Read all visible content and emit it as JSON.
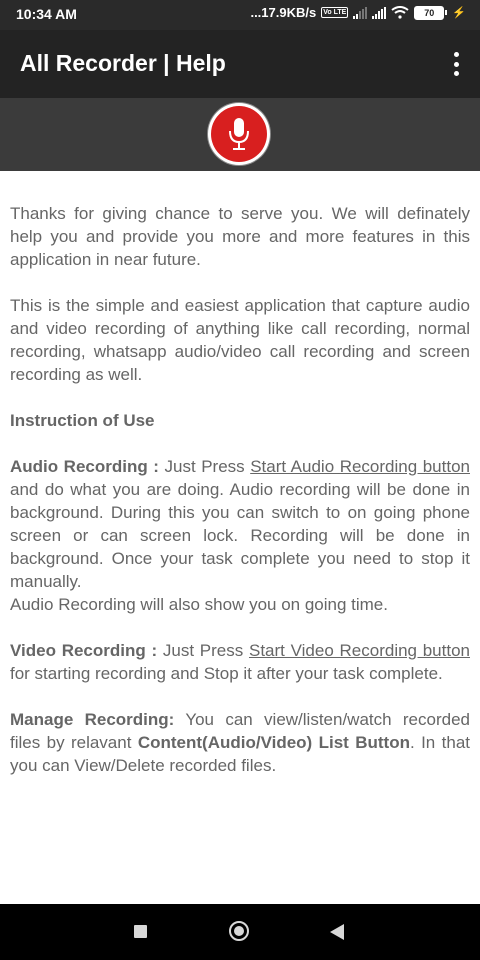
{
  "status_bar": {
    "time": "10:34 AM",
    "network_speed": "...17.9KB/s",
    "volte": "Vo LTE",
    "battery": "70"
  },
  "app_bar": {
    "title": "All Recorder | Help"
  },
  "icons": {
    "mic": "microphone-icon",
    "overflow": "more-vert-icon",
    "nav_recents": "square-icon",
    "nav_home": "circle-icon",
    "nav_back": "triangle-back-icon"
  },
  "colors": {
    "mic_button": "#d81f1f",
    "app_bar": "#232323",
    "mic_band": "#3b3b3b",
    "text": "#666666"
  },
  "help": {
    "intro": "Thanks for giving chance to serve you. We will definately help you and provide you more and more features in this application in near future.",
    "description": "This is the simple and easiest application that capture audio and video recording of anything like call recording, normal recording, whatsapp audio/video call recording and screen recording as well.",
    "instruction_heading": "Instruction of Use",
    "audio": {
      "label": "Audio Recording :",
      "pre": " Just Press ",
      "link": "Start Audio Recording button",
      "post": " and do what you are doing. Audio recording will be done in background. During this you can switch to on going phone screen or can screen lock. Recording will be done in background. Once your task complete you need to stop it manually.",
      "extra": "Audio Recording will also show you on going time."
    },
    "video": {
      "label": "Video Recording :",
      "pre": " Just Press ",
      "link": "Start Video Recording button",
      "post": " for starting recording and Stop it after your task complete."
    },
    "manage": {
      "label": "Manage Recording:",
      "pre": " You can view/listen/watch recorded files by relavant ",
      "bold": "Content(Audio/Video) List Button",
      "post": ". In that you can View/Delete recorded files."
    }
  }
}
